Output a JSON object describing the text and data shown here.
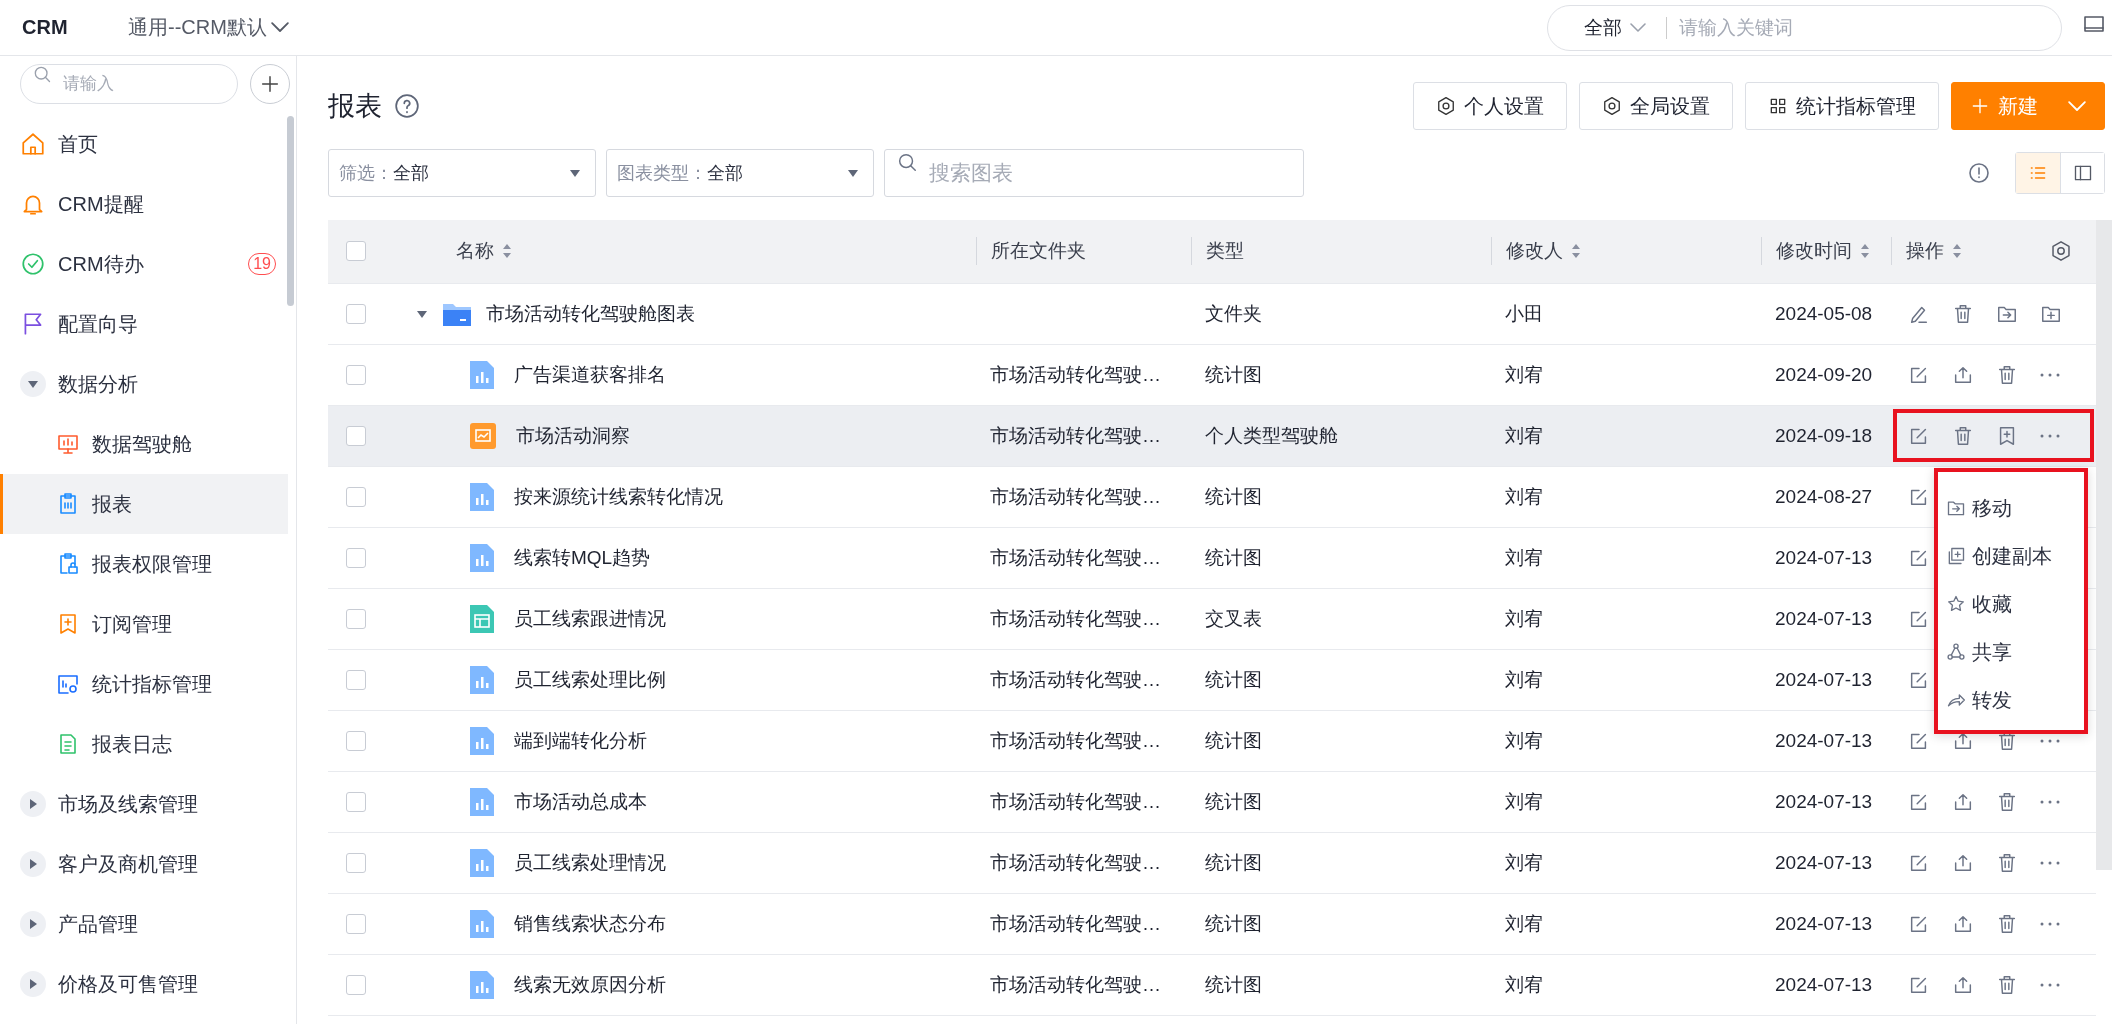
{
  "topbar": {
    "logo": "CRM",
    "workspace": "通用--CRM默认",
    "scope": "全部",
    "search_placeholder": "请输入关键词"
  },
  "sidebar": {
    "search_placeholder": "请输入",
    "items": [
      {
        "label": "首页",
        "kind": "link",
        "selected": false
      },
      {
        "label": "CRM提醒",
        "kind": "link",
        "selected": false
      },
      {
        "label": "CRM待办",
        "kind": "link",
        "selected": false,
        "badge": "19"
      },
      {
        "label": "配置向导",
        "kind": "link",
        "selected": false
      },
      {
        "label": "数据分析",
        "kind": "group",
        "expanded": true,
        "children": [
          {
            "label": "数据驾驶舱",
            "selected": false
          },
          {
            "label": "报表",
            "selected": true
          },
          {
            "label": "报表权限管理",
            "selected": false
          },
          {
            "label": "订阅管理",
            "selected": false
          },
          {
            "label": "统计指标管理",
            "selected": false
          },
          {
            "label": "报表日志",
            "selected": false
          }
        ]
      },
      {
        "label": "市场及线索管理",
        "kind": "group",
        "expanded": false
      },
      {
        "label": "客户及商机管理",
        "kind": "group",
        "expanded": false
      },
      {
        "label": "产品管理",
        "kind": "group",
        "expanded": false
      },
      {
        "label": "价格及可售管理",
        "kind": "group",
        "expanded": false
      }
    ]
  },
  "page": {
    "title": "报表",
    "buttons": [
      "个人设置",
      "全局设置",
      "统计指标管理"
    ],
    "new_button": "新建",
    "filters": [
      {
        "label": "筛选：",
        "value": "全部"
      },
      {
        "label": "图表类型：",
        "value": "全部"
      }
    ],
    "search_placeholder": "搜索图表",
    "view_modes": [
      {
        "selected": true
      },
      {
        "selected": false
      }
    ]
  },
  "table": {
    "header_checked": false,
    "columns": [
      {
        "label": "名称",
        "sortable": true
      },
      {
        "label": "所在文件夹",
        "sortable": false
      },
      {
        "label": "类型",
        "sortable": false
      },
      {
        "label": "修改人",
        "sortable": true
      },
      {
        "label": "修改时间",
        "sortable": true
      },
      {
        "label": "操作",
        "sortable": true
      }
    ],
    "rows": [
      {
        "name": "市场活动转化驾驶舱图表",
        "kind": "folder",
        "expanded": true,
        "checked": false,
        "selected": false,
        "annotated": false,
        "type": "文件夹",
        "modifier": "小田",
        "time": "2024-05-08",
        "actions": [
          {
            "kind": "rename"
          },
          {
            "kind": "delete"
          },
          {
            "kind": "move"
          },
          {
            "kind": "new-folder"
          }
        ],
        "children": [
          {
            "name": "广告渠道获客排名",
            "kind": "chart",
            "checked": false,
            "selected": false,
            "annotated": false,
            "folder": "市场活动转化驾驶…",
            "type": "统计图",
            "modifier": "刘宥",
            "time": "2024-09-20",
            "actions": [
              {
                "kind": "edit"
              },
              {
                "kind": "share"
              },
              {
                "kind": "delete"
              },
              {
                "kind": "more"
              }
            ]
          },
          {
            "name": "市场活动洞察",
            "kind": "dashboard",
            "checked": false,
            "selected": true,
            "annotated": true,
            "folder": "市场活动转化驾驶…",
            "type": "个人类型驾驶舱",
            "modifier": "刘宥",
            "time": "2024-09-18",
            "actions": [
              {
                "kind": "edit"
              },
              {
                "kind": "delete"
              },
              {
                "kind": "subscribe"
              },
              {
                "kind": "more"
              }
            ]
          },
          {
            "name": "按来源统计线索转化情况",
            "kind": "chart",
            "checked": false,
            "selected": false,
            "annotated": false,
            "folder": "市场活动转化驾驶…",
            "type": "统计图",
            "modifier": "刘宥",
            "time": "2024-08-27",
            "actions": [
              {
                "kind": "edit"
              }
            ]
          },
          {
            "name": "线索转MQL趋势",
            "kind": "chart",
            "checked": false,
            "selected": false,
            "annotated": false,
            "folder": "市场活动转化驾驶…",
            "type": "统计图",
            "modifier": "刘宥",
            "time": "2024-07-13",
            "actions": [
              {
                "kind": "edit"
              }
            ]
          },
          {
            "name": "员工线索跟进情况",
            "kind": "crosstab",
            "checked": false,
            "selected": false,
            "annotated": false,
            "folder": "市场活动转化驾驶…",
            "type": "交叉表",
            "modifier": "刘宥",
            "time": "2024-07-13",
            "actions": [
              {
                "kind": "edit"
              }
            ]
          },
          {
            "name": "员工线索处理比例",
            "kind": "chart",
            "checked": false,
            "selected": false,
            "annotated": false,
            "folder": "市场活动转化驾驶…",
            "type": "统计图",
            "modifier": "刘宥",
            "time": "2024-07-13",
            "actions": [
              {
                "kind": "edit"
              }
            ]
          },
          {
            "name": "端到端转化分析",
            "kind": "chart",
            "checked": false,
            "selected": false,
            "annotated": false,
            "folder": "市场活动转化驾驶…",
            "type": "统计图",
            "modifier": "刘宥",
            "time": "2024-07-13",
            "actions": [
              {
                "kind": "edit"
              },
              {
                "kind": "share"
              },
              {
                "kind": "delete"
              },
              {
                "kind": "more"
              }
            ]
          },
          {
            "name": "市场活动总成本",
            "kind": "chart",
            "checked": false,
            "selected": false,
            "annotated": false,
            "folder": "市场活动转化驾驶…",
            "type": "统计图",
            "modifier": "刘宥",
            "time": "2024-07-13",
            "actions": [
              {
                "kind": "edit"
              },
              {
                "kind": "share"
              },
              {
                "kind": "delete"
              },
              {
                "kind": "more"
              }
            ]
          },
          {
            "name": "员工线索处理情况",
            "kind": "chart",
            "checked": false,
            "selected": false,
            "annotated": false,
            "folder": "市场活动转化驾驶…",
            "type": "统计图",
            "modifier": "刘宥",
            "time": "2024-07-13",
            "actions": [
              {
                "kind": "edit"
              },
              {
                "kind": "share"
              },
              {
                "kind": "delete"
              },
              {
                "kind": "more"
              }
            ]
          },
          {
            "name": "销售线索状态分布",
            "kind": "chart",
            "checked": false,
            "selected": false,
            "annotated": false,
            "folder": "市场活动转化驾驶…",
            "type": "统计图",
            "modifier": "刘宥",
            "time": "2024-07-13",
            "actions": [
              {
                "kind": "edit"
              },
              {
                "kind": "share"
              },
              {
                "kind": "delete"
              },
              {
                "kind": "more"
              }
            ]
          },
          {
            "name": "线索无效原因分析",
            "kind": "chart",
            "checked": false,
            "selected": false,
            "annotated": false,
            "folder": "市场活动转化驾驶…",
            "type": "统计图",
            "modifier": "刘宥",
            "time": "2024-07-13",
            "actions": [
              {
                "kind": "edit"
              },
              {
                "kind": "share"
              },
              {
                "kind": "delete"
              },
              {
                "kind": "more"
              }
            ]
          }
        ]
      }
    ]
  },
  "menu": {
    "annotated": true,
    "items": [
      "移动",
      "创建副本",
      "收藏",
      "共享",
      "转发"
    ]
  }
}
